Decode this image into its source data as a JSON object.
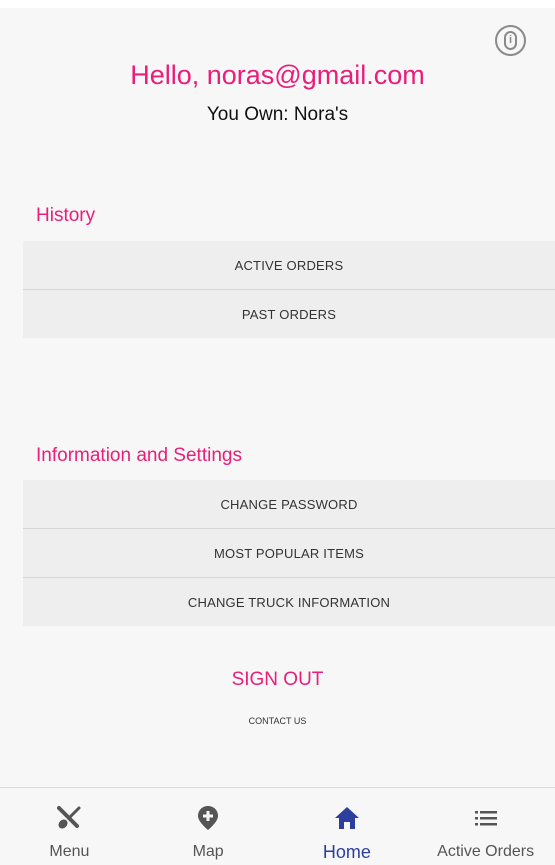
{
  "header": {
    "greeting": "Hello, noras@gmail.com",
    "owner_text": "You Own: Nora's",
    "info_icon": "info-icon"
  },
  "history": {
    "heading": "History",
    "buttons": [
      "ACTIVE ORDERS",
      "PAST ORDERS"
    ]
  },
  "settings": {
    "heading": "Information and Settings",
    "buttons": [
      "CHANGE PASSWORD",
      "MOST POPULAR ITEMS",
      "CHANGE TRUCK INFORMATION"
    ]
  },
  "actions": {
    "sign_out": "SIGN OUT",
    "contact_us": "CONTACT US"
  },
  "bottom_nav": {
    "items": [
      {
        "label": "Menu",
        "icon": "utensils-icon"
      },
      {
        "label": "Map",
        "icon": "map-pin-icon"
      },
      {
        "label": "Home",
        "icon": "home-icon"
      },
      {
        "label": "Active Orders",
        "icon": "list-icon"
      }
    ],
    "active": "Home"
  },
  "colors": {
    "accent": "#e91e7a",
    "nav_active": "#2c3e9e",
    "icon_inactive": "#555555",
    "button_bg": "#eeeeee"
  }
}
